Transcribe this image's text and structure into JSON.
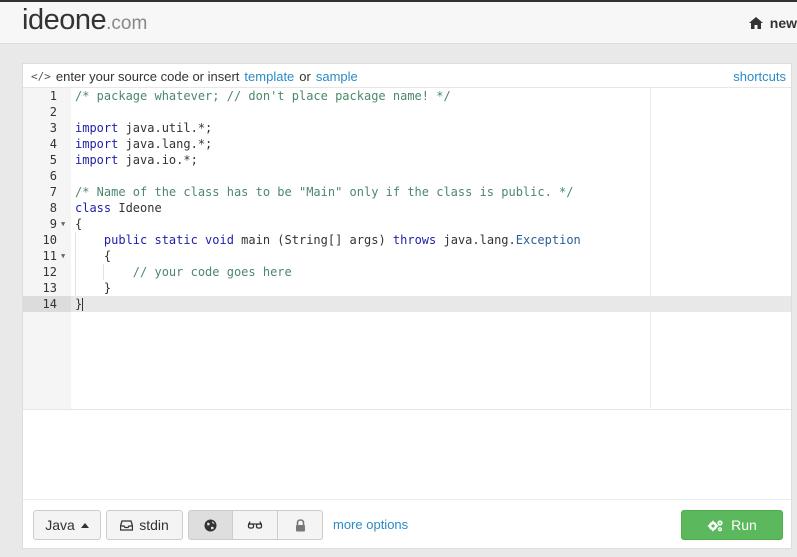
{
  "header": {
    "logo_main": "ideone",
    "logo_suffix": ".com",
    "new_label": "new"
  },
  "editor_bar": {
    "prefix": "enter your source code or insert",
    "template_link": "template",
    "or": "or",
    "sample_link": "sample",
    "shortcuts_link": "shortcuts"
  },
  "editor": {
    "line_numbers": [
      "1",
      "2",
      "3",
      "4",
      "5",
      "6",
      "7",
      "8",
      "9",
      "10",
      "11",
      "12",
      "13",
      "14"
    ],
    "active_line": 14,
    "lines": {
      "l1_comment": "/* package whatever; // don't place package name! */",
      "l3_kw": "import",
      "l3_rest": " java.util.*;",
      "l4_kw": "import",
      "l4_rest": " java.lang.*;",
      "l5_kw": "import",
      "l5_rest": " java.io.*;",
      "l7_comment": "/* Name of the class has to be \"Main\" only if the class is public. */",
      "l8_kw": "class",
      "l8_rest": " Ideone",
      "l9": "{",
      "l10_kw1": "public static void",
      "l10_mid": " main (String[] args) ",
      "l10_kw2": "throws",
      "l10_pkg": " java.lang.",
      "l10_type": "Exception",
      "l11": "{",
      "l12_comment": "// your code goes here",
      "l13": "}",
      "l14": "}"
    }
  },
  "toolbar": {
    "language": "Java",
    "stdin": "stdin",
    "more_options": "more options",
    "run": "Run"
  },
  "colors": {
    "accent_link": "#2a8bc7",
    "run_button": "#5cb85c",
    "comment": "#4c886b",
    "keyword": "#1f1fa8"
  },
  "icons": {
    "home": "home-icon",
    "code": "code-icon",
    "stdin": "inbox-icon",
    "public": "globe-icon",
    "hidden": "glasses-icon",
    "private": "lock-icon",
    "run": "gears-icon"
  }
}
